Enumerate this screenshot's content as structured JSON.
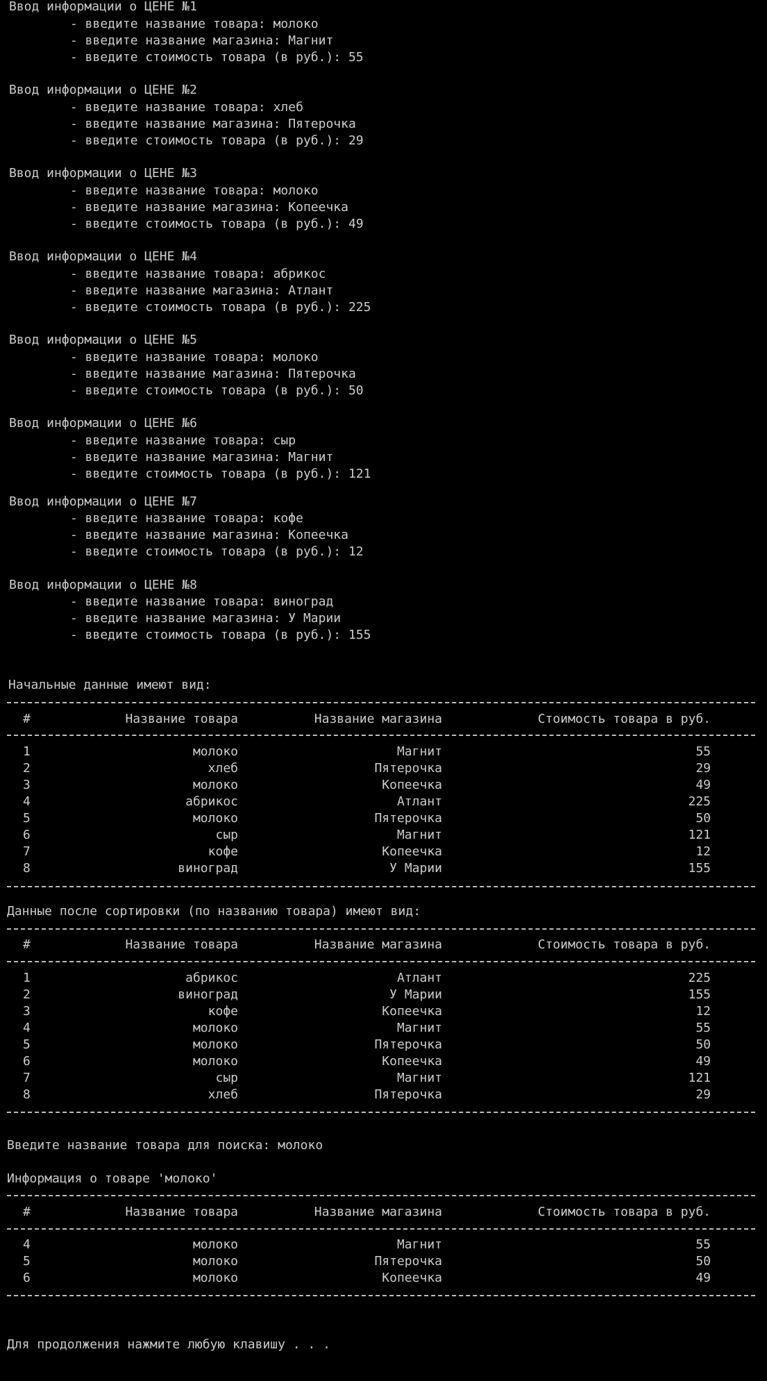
{
  "input_blocks": [
    {
      "header": "Ввод информации о ЦЕНЕ №1",
      "lines": [
        "- введите название товара: молоко",
        "- введите название магазина: Магнит",
        "- введите стоимость товара (в руб.): 55"
      ]
    },
    {
      "header": "Ввод информации о ЦЕНЕ №2",
      "lines": [
        "- введите название товара: хлеб",
        "- введите название магазина: Пятерочка",
        "- введите стоимость товара (в руб.): 29"
      ]
    },
    {
      "header": "Ввод информации о ЦЕНЕ №3",
      "lines": [
        "- введите название товара: молоко",
        "- введите название магазина: Копеечка",
        "- введите стоимость товара (в руб.): 49"
      ]
    },
    {
      "header": "Ввод информации о ЦЕНЕ №4",
      "lines": [
        "- введите название товара: абрикос",
        "- введите название магазина: Атлант",
        "- введите стоимость товара (в руб.): 225"
      ]
    },
    {
      "header": "Ввод информации о ЦЕНЕ №5",
      "lines": [
        "- введите название товара: молоко",
        "- введите название магазина: Пятерочка",
        "- введите стоимость товара (в руб.): 50"
      ]
    },
    {
      "header": "Ввод информации о ЦЕНЕ №6",
      "lines": [
        "- введите название товара: сыр",
        "- введите название магазина: Магнит",
        "- введите стоимость товара (в руб.): 121"
      ]
    },
    {
      "header": "Ввод информации о ЦЕНЕ №7",
      "lines": [
        "- введите название товара: кофе",
        "- введите название магазина: Копеечка",
        "- введите стоимость товара (в руб.): 12"
      ]
    },
    {
      "header": "Ввод информации о ЦЕНЕ №8",
      "lines": [
        "- введите название товара: виноград",
        "- введите название магазина: У Марии",
        "- введите стоимость товара (в руб.): 155"
      ]
    }
  ],
  "columns": [
    "#",
    "Название товара",
    "Название магазина",
    "Стоимость товара в руб."
  ],
  "tables": [
    {
      "caption": "Начальные данные имеют вид:",
      "rows": [
        [
          "1",
          "молоко",
          "Магнит",
          "55"
        ],
        [
          "2",
          "хлеб",
          "Пятерочка",
          "29"
        ],
        [
          "3",
          "молоко",
          "Копеечка",
          "49"
        ],
        [
          "4",
          "абрикос",
          "Атлант",
          "225"
        ],
        [
          "5",
          "молоко",
          "Пятерочка",
          "50"
        ],
        [
          "6",
          "сыр",
          "Магнит",
          "121"
        ],
        [
          "7",
          "кофе",
          "Копеечка",
          "12"
        ],
        [
          "8",
          "виноград",
          "У Марии",
          "155"
        ]
      ]
    },
    {
      "caption": "Данные после сортировки (по названию товара) имеют вид:",
      "rows": [
        [
          "1",
          "абрикос",
          "Атлант",
          "225"
        ],
        [
          "2",
          "виноград",
          "У Марии",
          "155"
        ],
        [
          "3",
          "кофе",
          "Копеечка",
          "12"
        ],
        [
          "4",
          "молоко",
          "Магнит",
          "55"
        ],
        [
          "5",
          "молоко",
          "Пятерочка",
          "50"
        ],
        [
          "6",
          "молоко",
          "Копеечка",
          "49"
        ],
        [
          "7",
          "сыр",
          "Магнит",
          "121"
        ],
        [
          "8",
          "хлеб",
          "Пятерочка",
          "29"
        ]
      ]
    },
    {
      "caption": "Информация о товаре 'молоко'",
      "rows": [
        [
          "4",
          "молоко",
          "Магнит",
          "55"
        ],
        [
          "5",
          "молоко",
          "Пятерочка",
          "50"
        ],
        [
          "6",
          "молоко",
          "Копеечка",
          "49"
        ]
      ]
    }
  ],
  "search_prompt": "Введите название товара для поиска: молоко",
  "continue_prompt": "Для продолжения нажмите любую клавишу . . ."
}
